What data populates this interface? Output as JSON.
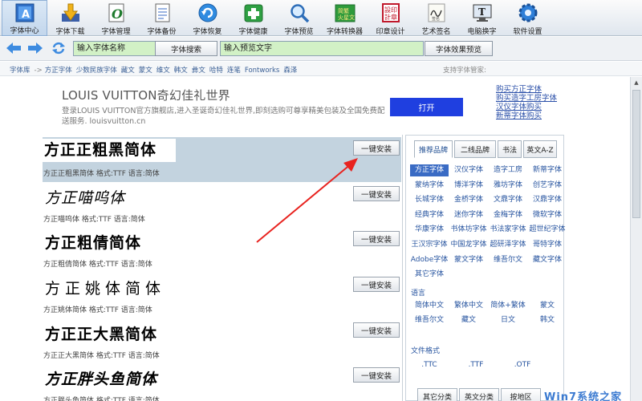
{
  "toolbar": {
    "items": [
      {
        "label": "字体中心",
        "icon": "font-center-icon"
      },
      {
        "label": "字体下载",
        "icon": "download-icon"
      },
      {
        "label": "字体管理",
        "icon": "font-manage-icon"
      },
      {
        "label": "字体备份",
        "icon": "backup-icon"
      },
      {
        "label": "字体恢复",
        "icon": "restore-icon"
      },
      {
        "label": "字体健康",
        "icon": "health-icon"
      },
      {
        "label": "字体预览",
        "icon": "magnifier-icon"
      },
      {
        "label": "字体转换器",
        "icon": "converter-icon"
      },
      {
        "label": "印章设计",
        "icon": "seal-icon"
      },
      {
        "label": "艺术签名",
        "icon": "signature-icon"
      },
      {
        "label": "电脑换字",
        "icon": "monitor-icon"
      },
      {
        "label": "软件设置",
        "icon": "gear-icon"
      }
    ]
  },
  "search": {
    "font_name_placeholder": "输入字体名称",
    "search_button": "字体搜索",
    "preview_placeholder": "输入预览文字",
    "preview_button": "字体效果预览"
  },
  "breadcrumb": {
    "items": [
      "字体库",
      "方正字体",
      "少数民族字体",
      "藏文",
      "蒙文",
      "维文",
      "韩文",
      "彝文",
      "哈特",
      "连笔",
      "Fontworks",
      "森泽"
    ],
    "admin_label": "支持字体管家:"
  },
  "ad": {
    "title": "LOUIS VUITTON奇幻佳礼世界",
    "description": "登录LOUIS VUITTON官方旗舰店,进入圣诞奇幻佳礼世界,即刻选购可尊享精美包装及全国免费配送服务. louisvuitton.cn",
    "open_button": "打开",
    "links": [
      "购买方正字体",
      "购买造字工房字体",
      "汉仪字体购买",
      "新蒂字体购买"
    ]
  },
  "fonts": [
    {
      "preview": "方正正粗黑简体",
      "meta": "方正正粗黑简体  格式:TTF 语言:简体",
      "install": "一键安装"
    },
    {
      "preview": "方正喵呜体",
      "meta": "方正喵呜体  格式:TTF 语言:简体",
      "install": "一键安装"
    },
    {
      "preview": "方正粗倩简体",
      "meta": "方正粗倩简体  格式:TTF 语言:简体",
      "install": "一键安装"
    },
    {
      "preview": "方正姚体简体",
      "meta": "方正姚体简体  格式:TTF 语言:简体",
      "install": "一键安装"
    },
    {
      "preview": "方正正大黑简体",
      "meta": "方正正大黑简体  格式:TTF 语言:简体",
      "install": "一键安装"
    },
    {
      "preview": "方正胖头鱼简体",
      "meta": "方正胖头鱼简体  格式:TTF 语言:简体",
      "install": "一键安装"
    }
  ],
  "panel": {
    "tabs": [
      "推荐品牌",
      "二线品牌",
      "书法",
      "英文A-Z"
    ],
    "brands": [
      "方正字体",
      "汉仪字体",
      "造字工房",
      "新蒂字体",
      "蒙纳字体",
      "博洋字体",
      "雅坊字体",
      "创艺字体",
      "长城字体",
      "金桥字体",
      "文鼎字体",
      "汉鼎字体",
      "经典字体",
      "迷你字体",
      "金梅字体",
      "微软字体",
      "华康字体",
      "书体坊字体",
      "书法家字体",
      "超世纪字体",
      "王汉宗字体",
      "中国龙字体",
      "超研泽字体",
      "哥特字体",
      "Adobe字体",
      "蒙文字体",
      "维吾尔文",
      "藏文字体",
      "其它字体"
    ],
    "language_title": "语言",
    "languages": [
      "简体中文",
      "繁体中文",
      "简体+繁体",
      "蒙文",
      "维吾尔文",
      "藏文",
      "日文",
      "韩文"
    ],
    "format_title": "文件格式",
    "formats": [
      ".TTC",
      ".TTF",
      ".OTF"
    ],
    "bottom_tabs": [
      "其它分类",
      "英文分类",
      "按地区"
    ]
  },
  "watermark": "Win7系统之家"
}
